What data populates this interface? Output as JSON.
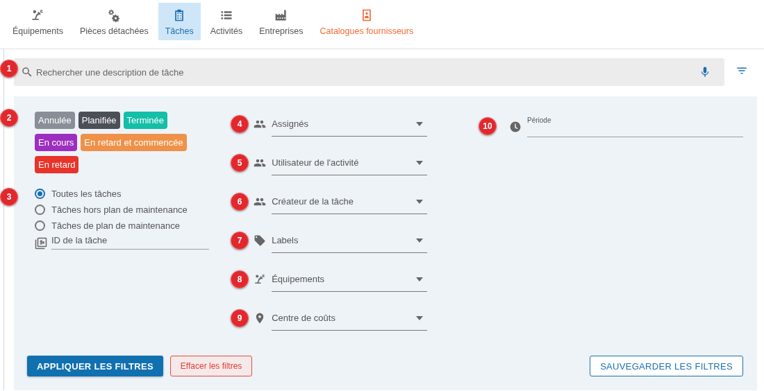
{
  "tabs": [
    {
      "label": "Équipements",
      "selected": false,
      "highlighted": false
    },
    {
      "label": "Pièces détachées",
      "selected": false,
      "highlighted": false
    },
    {
      "label": "Tâches",
      "selected": true,
      "highlighted": false
    },
    {
      "label": "Activités",
      "selected": false,
      "highlighted": false
    },
    {
      "label": "Entreprises",
      "selected": false,
      "highlighted": false
    },
    {
      "label": "Catalogues fournisseurs",
      "selected": false,
      "highlighted": true
    }
  ],
  "search": {
    "marker": "1",
    "placeholder": "Rechercher une description de tâche"
  },
  "statuses": {
    "marker": "2",
    "chips": [
      {
        "label": "Annulée",
        "color": "#8a8f97"
      },
      {
        "label": "Planifiée",
        "color": "#4b4f56"
      },
      {
        "label": "Terminée",
        "color": "#13bfa6"
      },
      {
        "label": "En cours",
        "color": "#9c2fc0"
      },
      {
        "label": "En retard et commencée",
        "color": "#ef9148"
      },
      {
        "label": "En retard",
        "color": "#e8342a"
      }
    ]
  },
  "scope": {
    "marker": "3",
    "options": [
      {
        "label": "Toutes les tâches",
        "selected": true
      },
      {
        "label": "Tâches hors plan de maintenance",
        "selected": false
      },
      {
        "label": "Tâches de plan de maintenance",
        "selected": false
      }
    ]
  },
  "task_id": {
    "placeholder": "ID de la tâche"
  },
  "selects": [
    {
      "marker": "4",
      "label": "Assignés"
    },
    {
      "marker": "5",
      "label": "Utilisateur de l'activité"
    },
    {
      "marker": "6",
      "label": "Créateur de la tâche"
    },
    {
      "marker": "7",
      "label": "Labels"
    },
    {
      "marker": "8",
      "label": "Équipements"
    },
    {
      "marker": "9",
      "label": "Centre de coûts"
    }
  ],
  "period": {
    "marker": "10",
    "label": "Période"
  },
  "buttons": [
    {
      "label": "APPLIQUER LES FILTRES",
      "kind": "primary"
    },
    {
      "label": "Effacer les filtres",
      "kind": "danger"
    },
    {
      "label": "SAUVEGARDER LES FILTRES",
      "kind": "outline"
    }
  ]
}
